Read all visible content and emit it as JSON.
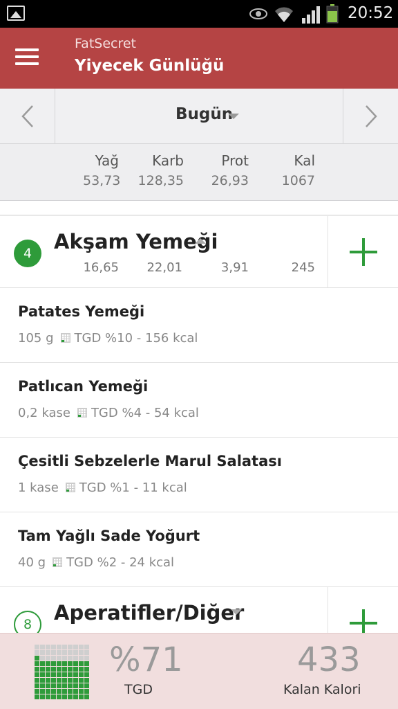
{
  "status_bar": {
    "time": "20:52",
    "icons": [
      "image-icon",
      "eye-icon",
      "wifi-icon",
      "signal-icon",
      "battery-icon"
    ],
    "battery_color": "#8bc34a"
  },
  "action_bar": {
    "app_name": "FatSecret",
    "title": "Yiyecek Günlüğü",
    "color": "#b54444"
  },
  "date_nav": {
    "label": "Bugün",
    "prev_icon": "chevron-left-icon",
    "next_icon": "chevron-right-icon"
  },
  "summary": {
    "columns": [
      {
        "label": "Yağ",
        "value": "53,73"
      },
      {
        "label": "Karb",
        "value": "128,35"
      },
      {
        "label": "Prot",
        "value": "26,93"
      },
      {
        "label": "Kal",
        "value": "1067"
      }
    ]
  },
  "meals": [
    {
      "badge": "4",
      "title": "Akşam Yemeği",
      "totals": [
        "16,65",
        "22,01",
        "3,91",
        "245"
      ],
      "items": [
        {
          "name": "Patates Yemeği",
          "amount": "105  g",
          "detail": "TGD %10 - 156 kcal"
        },
        {
          "name": "Patlıcan Yemeği",
          "amount": "0,2 kase",
          "detail": "TGD %4 - 54 kcal"
        },
        {
          "name": "Çesitli Sebzelerle Marul Salatası",
          "amount": "1  kase",
          "detail": "TGD %1 - 11 kcal"
        },
        {
          "name": "Tam Yağlı Sade Yoğurt",
          "amount": "40  g",
          "detail": "TGD %2 - 24 kcal"
        }
      ]
    },
    {
      "badge": "8",
      "title": "Aperatifler/Diğer"
    }
  ],
  "bottom_bar": {
    "percent": "%71",
    "percent_label": "TGD",
    "remaining": "433",
    "remaining_label": "Kalan Kalori",
    "rdi_fraction": 0.71,
    "accent": "#2e9b3a"
  }
}
